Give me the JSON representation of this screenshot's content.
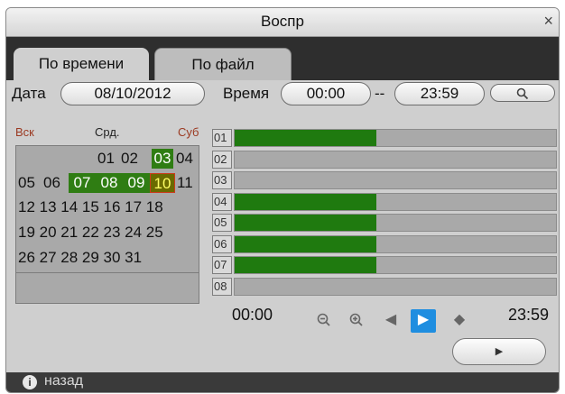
{
  "window": {
    "title": "Воспр",
    "close": "×"
  },
  "tabs": [
    {
      "label": "По времени",
      "active": true
    },
    {
      "label": "По файл",
      "active": false
    }
  ],
  "filter": {
    "date_label": "Дата",
    "date_value": "08/10/2012",
    "time_label": "Время",
    "time_start": "00:00",
    "time_sep": "--",
    "time_end": "23:59",
    "search_icon": "search-icon"
  },
  "calendar": {
    "weekday_labels": {
      "sun": "Вск",
      "wed": "Срд.",
      "sat": "Суб"
    },
    "rows": [
      "01 02 03 04",
      "05 06 07 08 09 10 11",
      "12 13 14 15 16 17 18",
      "19 20 21 22 23 24 25",
      "26 27 28 29 30 31"
    ],
    "highlighted_days": [
      "03",
      "07",
      "08",
      "09",
      "10"
    ],
    "selected_day": "10"
  },
  "channels": [
    {
      "id": "01",
      "has_record": true
    },
    {
      "id": "02",
      "has_record": false
    },
    {
      "id": "03",
      "has_record": false
    },
    {
      "id": "04",
      "has_record": true
    },
    {
      "id": "05",
      "has_record": true
    },
    {
      "id": "06",
      "has_record": true
    },
    {
      "id": "07",
      "has_record": true
    },
    {
      "id": "08",
      "has_record": false
    }
  ],
  "timeline": {
    "start": "00:00",
    "end": "23:59",
    "record_fraction": 0.44
  },
  "controls": {
    "play_icon": "play-icon",
    "zoom_out_icon": "zoom-out-icon",
    "zoom_in_icon": "zoom-in-icon",
    "prev_icon": "prev-icon",
    "clear_icon": "eraser-icon",
    "accent": "#1f8ee0"
  },
  "footer": {
    "info_icon": "i",
    "back": "назад"
  }
}
